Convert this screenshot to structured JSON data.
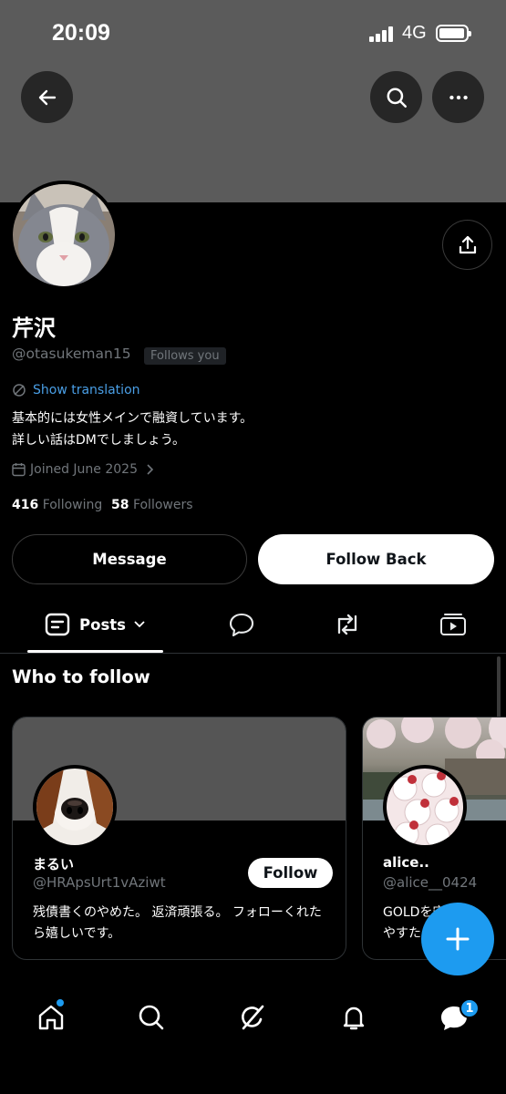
{
  "status_bar": {
    "time": "20:09",
    "network": "4G"
  },
  "header": {
    "back_icon": "arrow-left-icon",
    "search_icon": "search-icon",
    "more_icon": "more-horizontal-icon",
    "share_icon": "share-icon"
  },
  "profile": {
    "display_name": "芹沢",
    "handle": "@otasukeman15",
    "follows_you": "Follows you",
    "show_translation": "Show translation",
    "bio_line1": "基本的には女性メインで融資しています。",
    "bio_line2": "詳しい話はDMでしましょう。",
    "joined": "Joined June 2025",
    "following_count": "416",
    "following_label": "Following",
    "followers_count": "58",
    "followers_label": "Followers"
  },
  "actions": {
    "message_label": "Message",
    "follow_back_label": "Follow Back"
  },
  "tabs": {
    "posts_label": "Posts",
    "posts_icon": "posts-icon",
    "replies_icon": "reply-icon",
    "reposts_icon": "repost-icon",
    "media_icon": "media-icon"
  },
  "who_to_follow": {
    "title": "Who to follow",
    "cards": [
      {
        "name": "まるい",
        "handle": "@HRApsUrt1vAziwt",
        "follow_label": "Follow",
        "bio": "残債書くのやめた。 返済頑張る。 フォローくれたら嬉しいです。"
      },
      {
        "name": "alice..",
        "handle": "@alice__0424",
        "bio_line1": "GOLDを守る",
        "bio_line2": "やすた"
      }
    ]
  },
  "fab": {
    "icon": "plus-icon"
  },
  "bottom_nav": {
    "items": [
      "home-icon",
      "search-icon",
      "grok-icon",
      "notifications-icon",
      "messages-icon"
    ],
    "messages_badge": "1"
  },
  "colors": {
    "accent": "#1d9bf0",
    "background": "#000000",
    "muted": "#71767b",
    "banner": "#5b5b5b"
  }
}
